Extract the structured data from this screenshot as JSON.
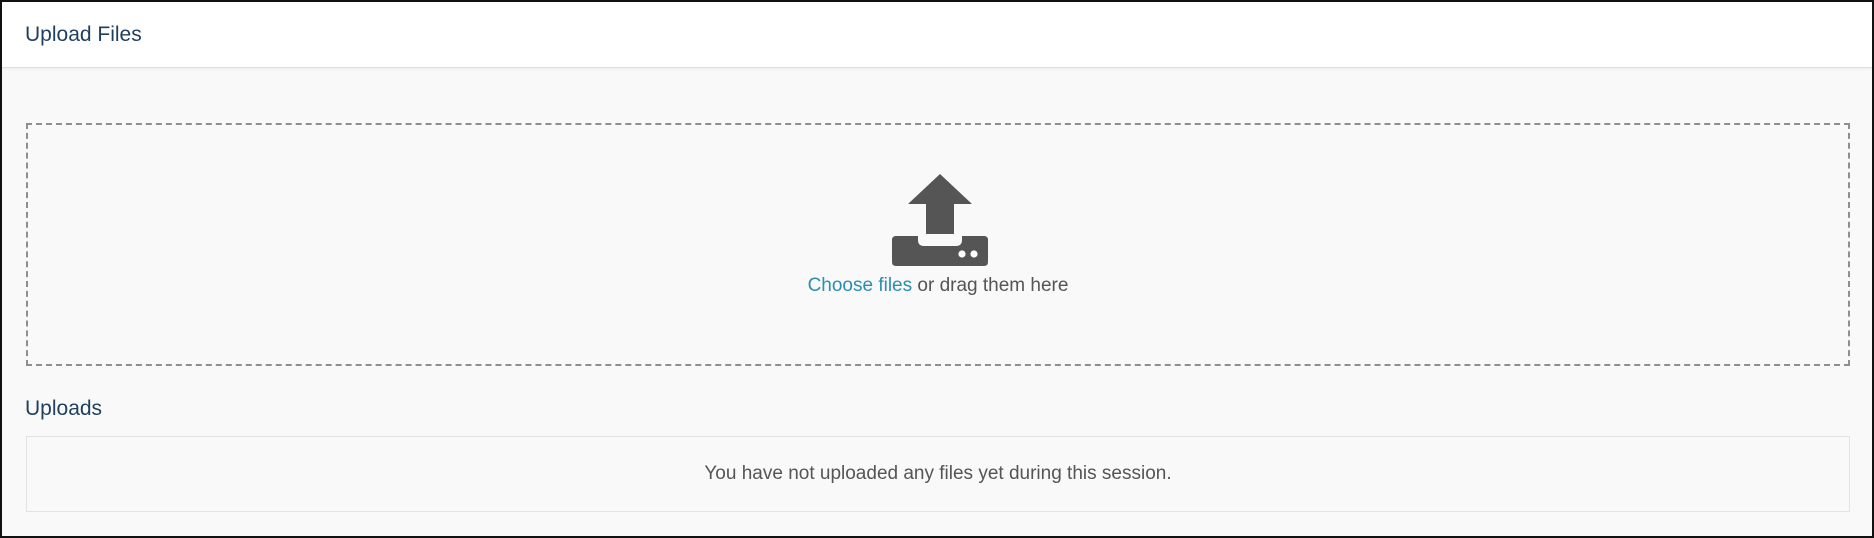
{
  "header": {
    "title": "Upload Files"
  },
  "dropzone": {
    "icon": "upload-tray-icon",
    "choose_label": "Choose files",
    "drag_text": " or drag them here"
  },
  "uploads": {
    "heading": "Uploads",
    "empty_message": "You have not uploaded any files yet during this session."
  },
  "colors": {
    "heading": "#1f3f5f",
    "link": "#2a8fb0",
    "icon": "#555555",
    "text": "#555555",
    "dashed_border": "#8f8f8f",
    "background": "#f9f9f9"
  }
}
